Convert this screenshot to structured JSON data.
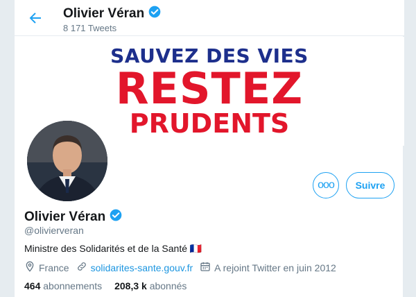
{
  "header": {
    "name": "Olivier Véran",
    "tweet_count": "8 171 Tweets"
  },
  "banner": {
    "line1": "SAUVEZ DES VIES",
    "line2": "RESTEZ",
    "line3": "PRUDENTS",
    "colors": {
      "blue": "#1d2f8c",
      "red": "#e2162b"
    }
  },
  "actions": {
    "more_label": "ooo",
    "follow_label": "Suivre"
  },
  "profile": {
    "name": "Olivier Véran",
    "handle": "@olivierveran",
    "bio": "Ministre des Solidarités et de la Santé 🇫🇷",
    "location": "France",
    "website": "solidarites-sante.gouv.fr",
    "joined": "A rejoint Twitter en juin 2012",
    "following_count": "464",
    "following_label": "abonnements",
    "followers_count": "208,3 k",
    "followers_label": "abonnés"
  },
  "icons": {
    "back": "arrow-left-icon",
    "verified": "verified-badge-icon",
    "location": "location-pin-icon",
    "link": "link-icon",
    "calendar": "calendar-icon"
  },
  "theme": {
    "accent": "#1da1f2",
    "muted": "#657786"
  }
}
